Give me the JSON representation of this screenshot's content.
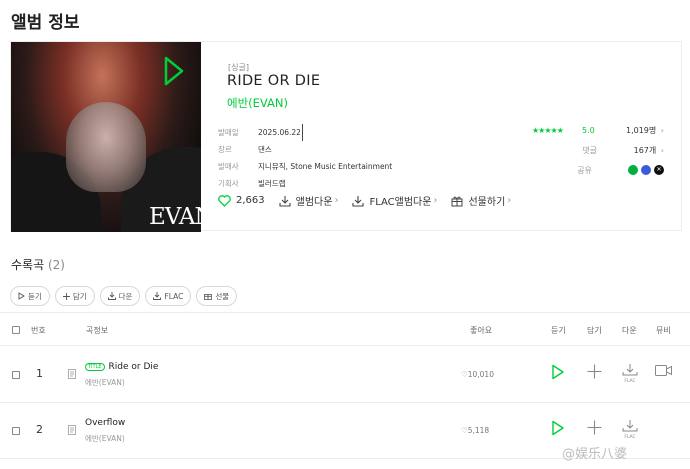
{
  "page": {
    "title": "앨범 정보"
  },
  "album": {
    "tag": "[싱글]",
    "title": "RIDE OR DIE",
    "artist": "에반(EVAN)",
    "cover_text": "EVAN",
    "meta": [
      {
        "label": "발매일",
        "value": "2025.06.22"
      },
      {
        "label": "장르",
        "value": "댄스"
      },
      {
        "label": "발매사",
        "value": "지니뮤직, Stone Music Entertainment"
      },
      {
        "label": "기획사",
        "value": "빌러드랩"
      }
    ],
    "rating": {
      "stars": "★★★★★",
      "score": "5.0",
      "count": "1,019명"
    },
    "comments": {
      "label": "댓글",
      "count": "167개"
    },
    "share": {
      "label": "공유"
    },
    "actions": {
      "likes": "2,663",
      "download": "앨범다운",
      "flac_download": "FLAC앨범다운",
      "gift": "선물하기"
    }
  },
  "tracks": {
    "title": "수록곡",
    "count": "(2)",
    "buttons": [
      "듣기",
      "담기",
      "다운",
      "FLAC",
      "선물"
    ],
    "headers": {
      "num": "번호",
      "info": "곡정보",
      "likes": "좋아요",
      "listen": "듣기",
      "add": "담기",
      "down": "다운",
      "mv": "뮤비"
    },
    "rows": [
      {
        "num": "1",
        "title": "Ride or Die",
        "badge": "TITLE",
        "artist": "에반(EVAN)",
        "likes": "10,010"
      },
      {
        "num": "2",
        "title": "Overflow",
        "badge": "",
        "artist": "에반(EVAN)",
        "likes": "5,118"
      }
    ]
  },
  "watermark": "@娱乐八婆",
  "colors": {
    "accent": "#00cd3c",
    "facebook": "#3b5bdb",
    "x": "#111111",
    "kakao": "#00b140"
  }
}
